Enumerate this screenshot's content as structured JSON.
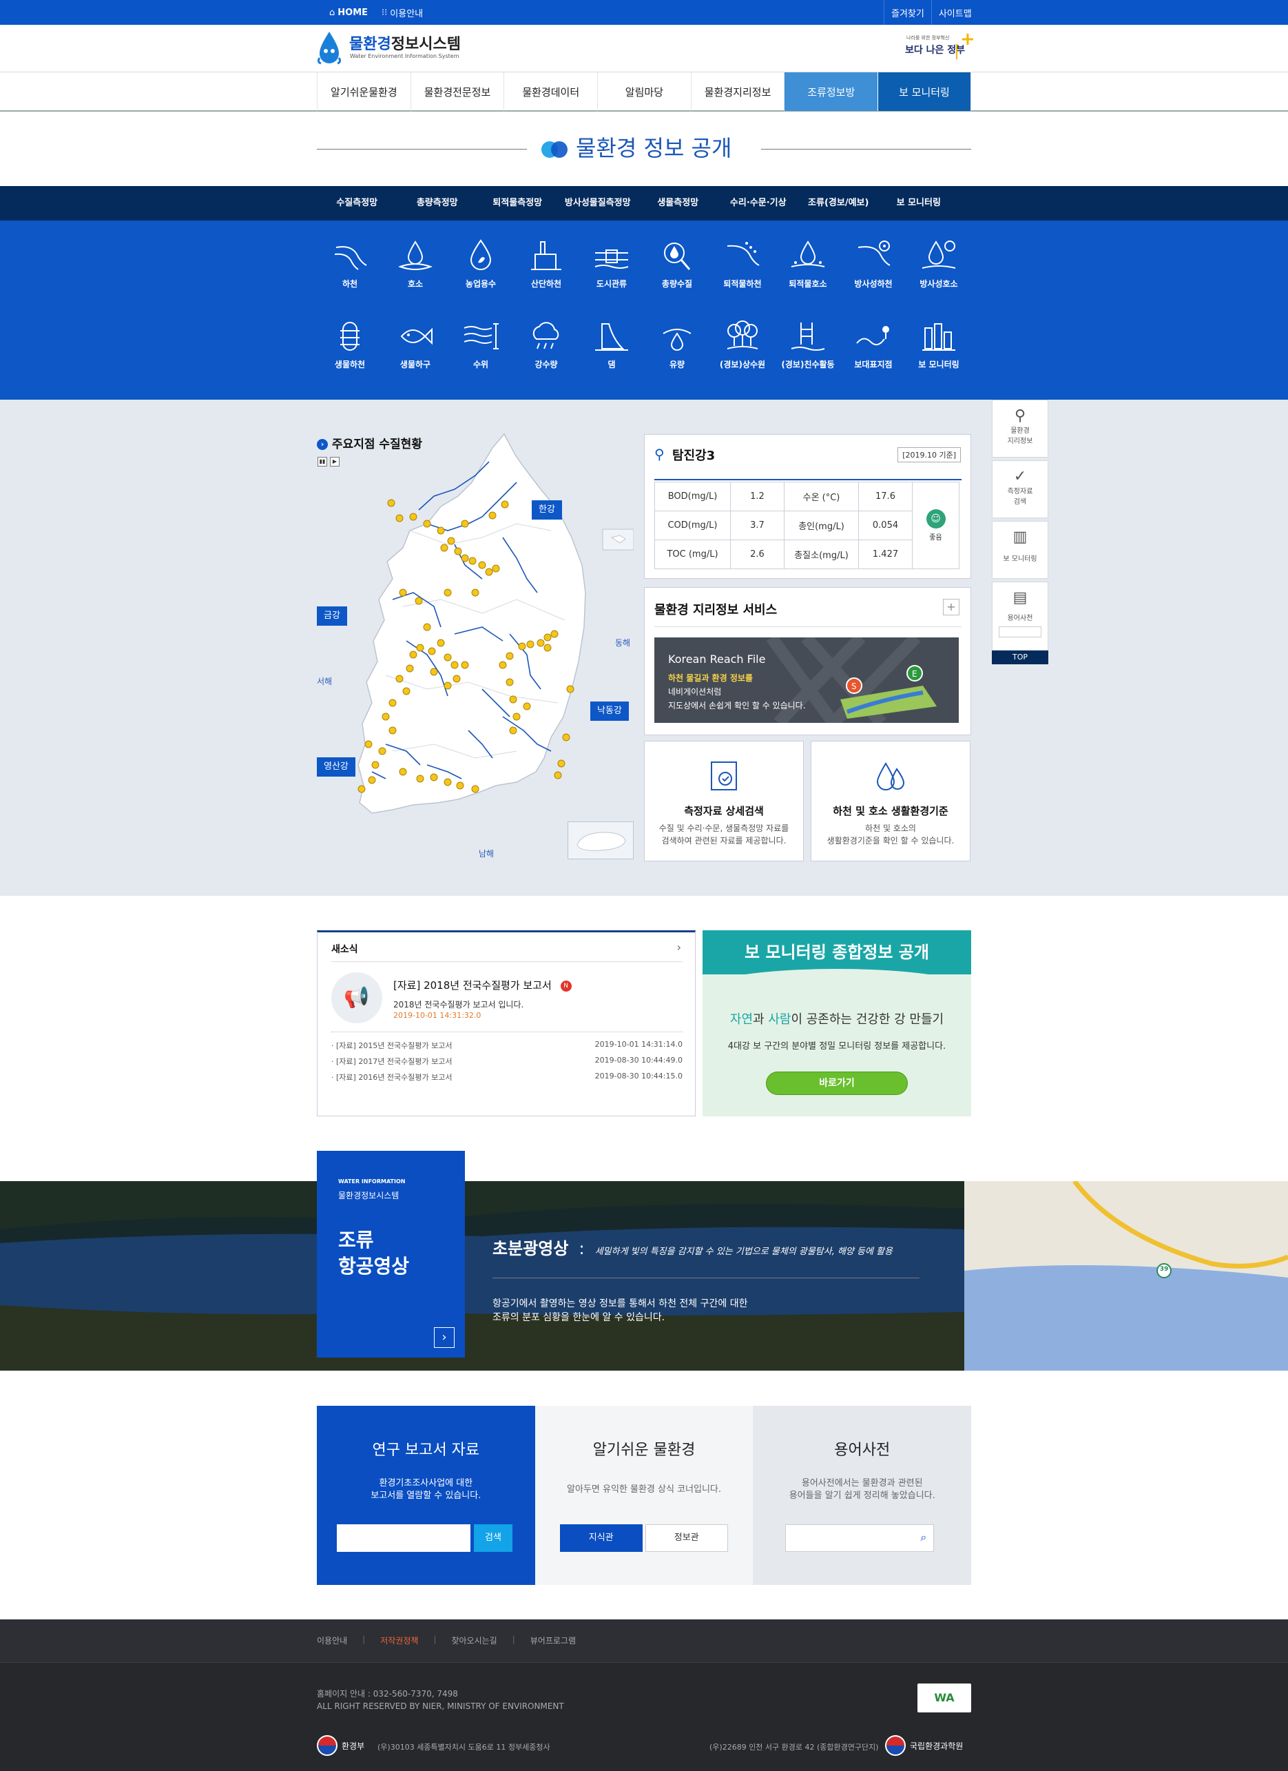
{
  "topbar": {
    "home": "HOME",
    "guide": "이용안내",
    "bookmark": "즐겨찾기",
    "sitemap": "사이트맵"
  },
  "header": {
    "logo_blue": "물환경",
    "logo_dark": "정보시스템",
    "logo_sub": "Water Environment Information System",
    "gov_top": "나라를 위한 정부혁신",
    "gov_text": "보다 나은 정부"
  },
  "gnb": [
    "알기쉬운물환경",
    "물환경전문정보",
    "물환경데이터",
    "알림마당",
    "물환경지리정보",
    "조류정보방",
    "보 모니터링"
  ],
  "page_title": "물환경 정보 공개",
  "subnav": [
    "수질측정망",
    "총량측정망",
    "퇴적물측정망",
    "방사성물질측정망",
    "생물측정망",
    "수리·수문·기상",
    "조류(경보/예보)",
    "보 모니터링"
  ],
  "icons_row1": [
    {
      "label": "하천",
      "icon": "river-icon"
    },
    {
      "label": "호소",
      "icon": "lake-icon"
    },
    {
      "label": "농업용수",
      "icon": "drop-leaf-icon"
    },
    {
      "label": "산단하천",
      "icon": "factory-icon"
    },
    {
      "label": "도시관류",
      "icon": "pipe-icon"
    },
    {
      "label": "총량수질",
      "icon": "magnifier-drop-icon"
    },
    {
      "label": "퇴적물하천",
      "icon": "sediment-river-icon"
    },
    {
      "label": "퇴적물호소",
      "icon": "sediment-lake-icon"
    },
    {
      "label": "방사성하천",
      "icon": "radioactive-river-icon"
    },
    {
      "label": "방사성호소",
      "icon": "radioactive-lake-icon"
    }
  ],
  "icons_row2": [
    {
      "label": "생물하천",
      "icon": "bio-river-icon"
    },
    {
      "label": "생물하구",
      "icon": "fish-icon"
    },
    {
      "label": "수위",
      "icon": "water-level-icon"
    },
    {
      "label": "강수량",
      "icon": "rain-icon"
    },
    {
      "label": "댐",
      "icon": "dam-icon"
    },
    {
      "label": "유량",
      "icon": "flow-icon"
    },
    {
      "label": "(경보)상수원",
      "icon": "tree-icon"
    },
    {
      "label": "(경보)친수활동",
      "icon": "pool-ladder-icon"
    },
    {
      "label": "보대표지점",
      "icon": "point-icon"
    },
    {
      "label": "보 모니터링",
      "icon": "weir-icon"
    }
  ],
  "map": {
    "title": "주요지점 수질현황",
    "regions": {
      "han": "한강",
      "geum": "금강",
      "nakdong": "낙동강",
      "yeongsan": "영산강"
    },
    "seas": {
      "east": "동해",
      "west": "서해",
      "south": "남해"
    }
  },
  "station": {
    "name": "탐진강3",
    "date": "[2019.10 기준]",
    "rows": [
      {
        "k1": "BOD(mg/L)",
        "v1": "1.2",
        "k2": "수온 (°C)",
        "v2": "17.6"
      },
      {
        "k1": "COD(mg/L)",
        "v1": "3.7",
        "k2": "총인(mg/L)",
        "v2": "0.054"
      },
      {
        "k1": "TOC (mg/L)",
        "v1": "2.6",
        "k2": "총질소(mg/L)",
        "v2": "1.427"
      }
    ],
    "grade": "좋음"
  },
  "geo": {
    "title": "물환경 지리정보 서비스",
    "banner_title": "Korean Reach File",
    "banner_l1": "하천 물길과 환경 정보를",
    "banner_l2": "네비게이션처럼",
    "banner_l3": "지도상에서 손쉽게 확인 할 수 있습니다."
  },
  "box1": {
    "title": "측정자료 상세검색",
    "l1": "수질 및 수리·수문, 생물측정망 자료를",
    "l2": "검색하여 관련된 자료를 제공합니다."
  },
  "box2": {
    "title": "하천 및 호소 생활환경기준",
    "l1": "하천 및 호소의",
    "l2": "생활환경기준을 확인 할 수 있습니다."
  },
  "quick": [
    {
      "label1": "물환경",
      "label2": "지리정보",
      "icon": "map-pin-icon"
    },
    {
      "label1": "측정자료",
      "label2": "검색",
      "icon": "check-search-icon"
    },
    {
      "label1": "보 모니터링",
      "label2": "",
      "icon": "weir-icon"
    },
    {
      "label1": "용어사전",
      "label2": "",
      "icon": "dictionary-icon"
    }
  ],
  "quick_top": "TOP",
  "news": {
    "title": "새소식",
    "headline": "[자료] 2018년 전국수질평가 보고서",
    "badge": "N",
    "desc": "2018년 전국수질평가 보고서 입니다.",
    "date": "2019-10-01 14:31:32.0",
    "items": [
      {
        "t": "· [자료] 2015년 전국수질평가 보고서",
        "d": "2019-10-01 14:31:14.0"
      },
      {
        "t": "· [자료] 2017년 전국수질평가 보고서",
        "d": "2019-08-30 10:44:49.0"
      },
      {
        "t": "· [자료] 2016년 전국수질평가 보고서",
        "d": "2019-08-30 10:44:15.0"
      }
    ]
  },
  "bo": {
    "title": "보 모니터링 종합정보 공개",
    "slogan_a": "자연",
    "slogan_b": "과 ",
    "slogan_c": "사람",
    "slogan_d": "이 공존하는 건강한 강 만들기",
    "desc": "4대강 보 구간의 분야별 정밀 모니터링 정보를 제공합니다.",
    "button": "바로가기"
  },
  "aerial": {
    "kicker": "WATER INFORMATION",
    "sub": "물환경정보시스템",
    "title1": "조류",
    "title2": "항공영상",
    "head": "초분광영상",
    "colon": ":",
    "head_desc": "세밀하게 빛의 특징을 감지할 수 있는 기법으로 물체의 광물탐사, 해양 등에 활용",
    "body1": "항공기에서 촬영하는 영상 정보를 통해서 하천 전체 구간에 대한",
    "body2": "조류의 분포 심황을 한눈에 알 수 있습니다.",
    "road_no": "39"
  },
  "bottom": {
    "b1": {
      "title": "연구 보고서 자료",
      "l1": "환경기초조사사업에 대한",
      "l2": "보고서를 열람할 수 있습니다.",
      "btn": "검색"
    },
    "b2": {
      "title": "알기쉬운 물환경",
      "l1": "알아두면 유익한 물환경 상식 코너입니다.",
      "tab1": "지식관",
      "tab2": "정보관"
    },
    "b3": {
      "title": "용어사전",
      "l1": "용어사전에서는 물환경과 관련된",
      "l2": "용어들을 알기 쉽게 정리해 놓았습니다."
    }
  },
  "footer": {
    "links": [
      "이용안내",
      "저작권정책",
      "찾아오시는길",
      "뷰어프로그램"
    ],
    "phone": "홈페이지 안내 : 032-560-7370, 7498",
    "copy": "ALL RIGHT RESERVED BY NIER, MINISTRY OF ENVIRONMENT",
    "left_org": "환경부",
    "left_addr": "(우)30103 세종특별자치시 도움6로 11 정부세종청사",
    "right_addr": "(우)22689 인천 서구 환경로 42 (종합환경연구단지)",
    "right_org": "국립환경과학원",
    "wa": "WA"
  },
  "colors": {
    "primary": "#0d57c7",
    "navy": "#052b5c",
    "green": "#6abf2e",
    "teal": "#1aa6a6"
  }
}
